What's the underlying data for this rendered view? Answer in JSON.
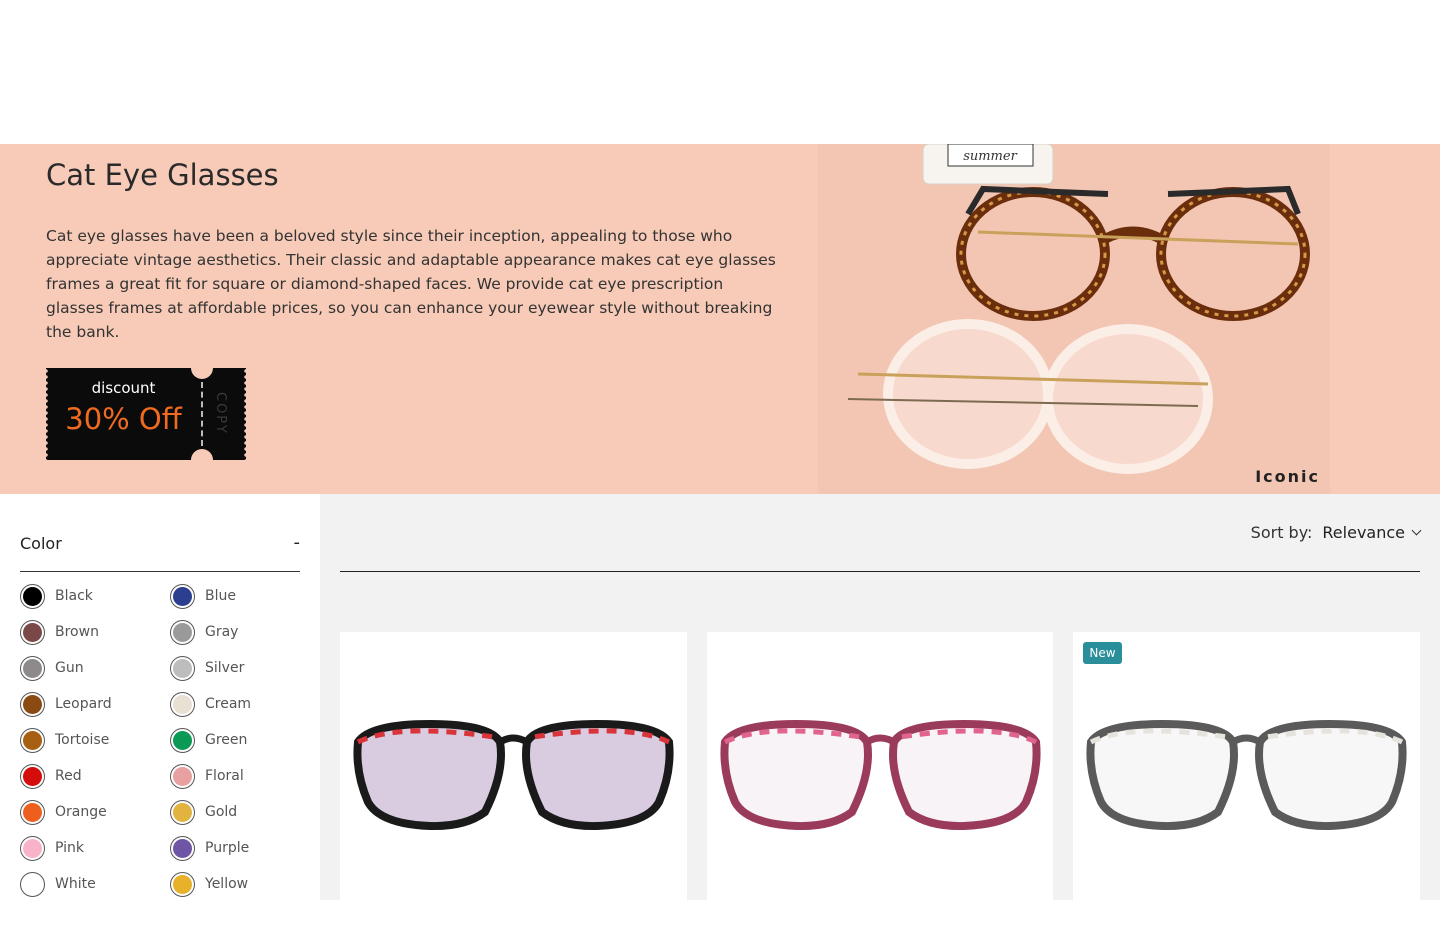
{
  "hero": {
    "title": "Cat Eye Glasses",
    "description": "Cat eye glasses have been a beloved style since their inception, appealing to those who appreciate vintage aesthetics. Their classic and adaptable appearance makes cat eye glasses frames a great fit for square or diamond-shaped faces. We provide cat eye prescription glasses frames at affordable prices, so you can enhance your eyewear style without breaking the bank.",
    "coupon": {
      "label": "discount",
      "value": "30% Off",
      "action": "COPY"
    },
    "brand": "Iconic",
    "bottle_text": "summer"
  },
  "filters": {
    "color": {
      "title": "Color",
      "toggle": "-",
      "options": [
        {
          "label": "Black",
          "swatch": "#000000"
        },
        {
          "label": "Blue",
          "swatch": "#2c3e8f"
        },
        {
          "label": "Brown",
          "swatch": "#7b4848"
        },
        {
          "label": "Gray",
          "swatch": "#9a9a9a"
        },
        {
          "label": "Gun",
          "swatch": "#8e8a8c"
        },
        {
          "label": "Silver",
          "swatch": "#bdbdbd"
        },
        {
          "label": "Leopard",
          "swatch": "#8a4a12"
        },
        {
          "label": "Cream",
          "swatch": "#e8e0d2"
        },
        {
          "label": "Tortoise",
          "swatch": "#a75f12"
        },
        {
          "label": "Green",
          "swatch": "#0a9a55"
        },
        {
          "label": "Red",
          "swatch": "#d40c0c"
        },
        {
          "label": "Floral",
          "swatch": "#e8a0a0"
        },
        {
          "label": "Orange",
          "swatch": "#ee5e1c"
        },
        {
          "label": "Gold",
          "swatch": "#e3b33f"
        },
        {
          "label": "Pink",
          "swatch": "#f8b3c8"
        },
        {
          "label": "Purple",
          "swatch": "#6e55a5"
        },
        {
          "label": "White",
          "swatch": "#ffffff"
        },
        {
          "label": "Yellow",
          "swatch": "#e8b12a"
        }
      ]
    }
  },
  "sort": {
    "label": "Sort by:",
    "value": "Relevance"
  },
  "products": [
    {
      "badge": "",
      "frame_color": "#1a1a1a",
      "accent": "#d8343a",
      "lens": "#b9a2c9"
    },
    {
      "badge": "",
      "frame_color": "#9b3b5c",
      "accent": "#e0648e",
      "lens": "#f2e9ee"
    },
    {
      "badge": "New",
      "frame_color": "#5a5a5a",
      "accent": "#e6e3dc",
      "lens": "#f0f0f0"
    }
  ],
  "colors": {
    "hero_bg": "#f7cbb8",
    "main_bg": "#f2f2f2",
    "coupon_accent": "#f06a1f",
    "badge": "#2b8f9b"
  }
}
